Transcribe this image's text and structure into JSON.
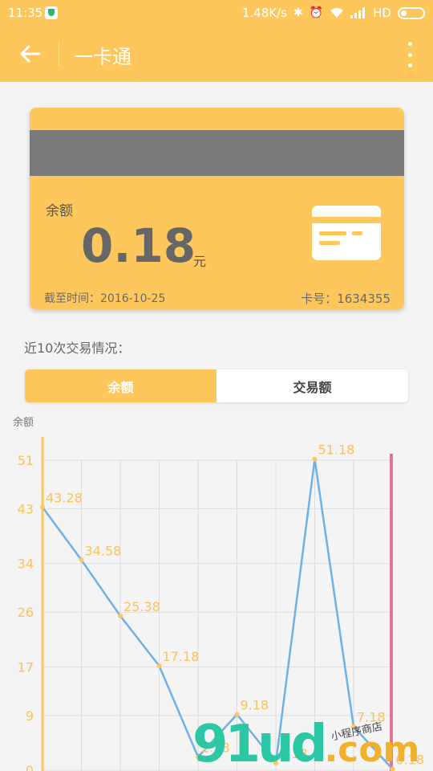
{
  "status_bar": {
    "time": "11:35",
    "network_speed": "1.48K/s",
    "network_type": "HD",
    "icons": [
      "shield-icon",
      "bluetooth-icon",
      "alarm-icon",
      "wifi-icon",
      "signal-icon",
      "battery-icon"
    ]
  },
  "app_bar": {
    "title": "一卡通",
    "back_icon": "back-arrow-icon",
    "more_icon": "more-vert-icon"
  },
  "card": {
    "balance_label": "余额",
    "balance_value": "0.18",
    "balance_unit": "元",
    "date_text": "截至时间：2016-10-25",
    "card_number_text": "卡号：1634355",
    "icon": "credit-card-icon"
  },
  "section_title": "近10次交易情况：",
  "toggle": {
    "balance_tab": "余额",
    "transaction_tab": "交易额",
    "selected": "余额"
  },
  "chart_data": {
    "type": "line",
    "ylabel": "余额",
    "y_ticks": [
      "51",
      "43",
      "34",
      "26",
      "17",
      "9",
      "0"
    ],
    "y_tick_values": [
      51,
      43,
      34,
      26,
      17,
      9,
      0
    ],
    "x": [
      1,
      2,
      3,
      4,
      5,
      6,
      7,
      8,
      9,
      10
    ],
    "values": [
      43.28,
      34.58,
      25.38,
      17.18,
      2.18,
      9.18,
      1.18,
      51.18,
      7.18,
      0.18
    ],
    "data_labels": [
      "43.28",
      "34.58",
      "25.38",
      "17.18",
      "2.18",
      "9.18",
      "1.18",
      "51.18",
      "7.18",
      "0.18"
    ],
    "ylim": [
      0,
      51
    ],
    "grid": true,
    "colors": {
      "line": "#6fb1e6",
      "point": "#fdc75c",
      "label": "#f8c35c",
      "axis": "#fdc75c",
      "highlight": "#e57399",
      "grid": "#dddddd"
    }
  },
  "watermark": {
    "main": "91ud",
    "suffix": ".com",
    "sub": "小程序商店"
  },
  "colors": {
    "accent": "#fdc75c",
    "card_strip": "#7a7a7a",
    "text_dark": "#666666"
  }
}
